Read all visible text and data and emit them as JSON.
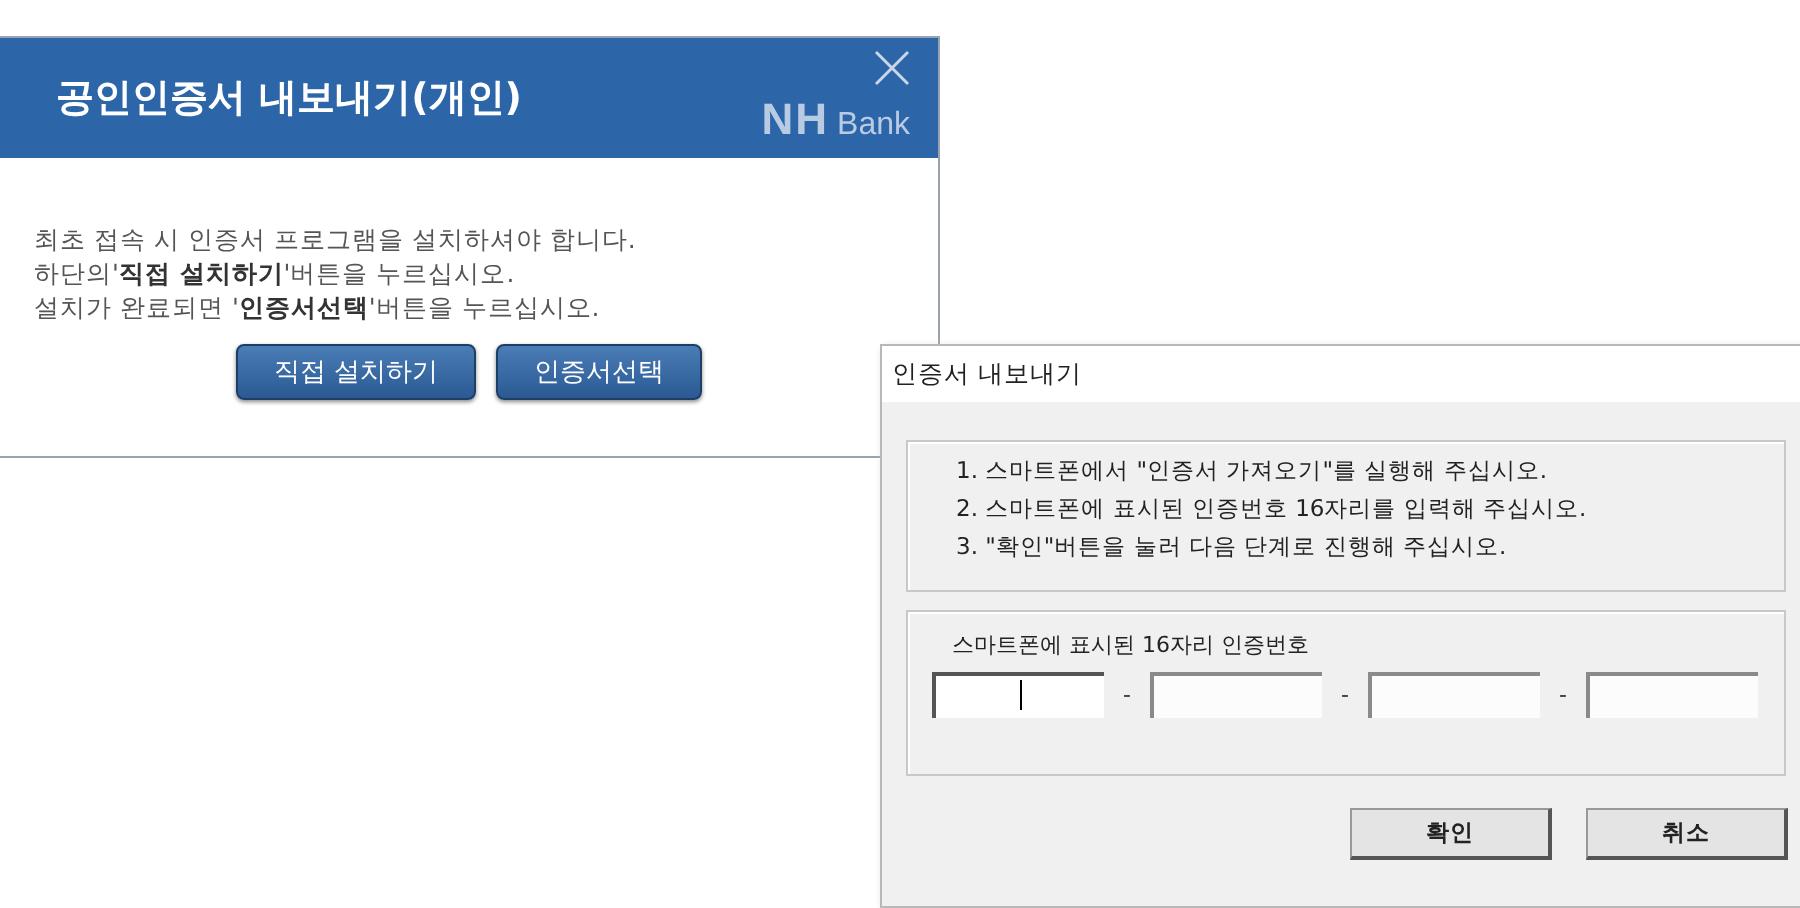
{
  "main_dialog": {
    "title": "공인인증서 내보내기(개인)",
    "logo": {
      "mark": "NH",
      "word": "Bank"
    },
    "lines": [
      "최초 접속 시 인증서 프로그램을 설치하셔야 합니다.",
      "하단의'**직접 설치하기**'버튼을 누르십시오.",
      "설치가 완료되면 '**인증서선택**'버튼을 누르십시오."
    ],
    "buttons": [
      "직접 설치하기",
      "인증서선택"
    ]
  },
  "export_dialog": {
    "title": "인증서 내보내기",
    "steps": [
      "1. 스마트폰에서 \"인증서 가져오기\"를 실행해 주십시오.",
      "2. 스마트폰에 표시된 인증번호 16자리를 입력해 주십시오.",
      "3. \"확인\"버튼을 눌러 다음 단계로 진행해 주십시오."
    ],
    "code_label": "스마트폰에 표시된 16자리 인증번호",
    "code_fields": [
      {
        "focused": true
      },
      {
        "focused": false,
        "separator": "-"
      },
      {
        "focused": false,
        "separator": "-"
      },
      {
        "focused": false,
        "separator": "-"
      }
    ],
    "buttons": [
      "확인",
      "취소"
    ]
  }
}
